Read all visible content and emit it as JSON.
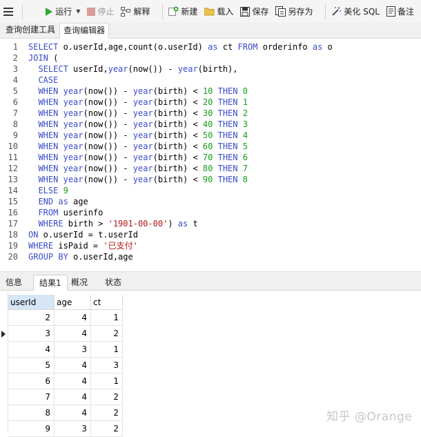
{
  "toolbar": {
    "run": "运行",
    "stop": "停止",
    "explain": "解释",
    "new": "新建",
    "load": "载入",
    "save": "保存",
    "save_as": "另存为",
    "beautify": "美化 SQL",
    "memo": "备注"
  },
  "tabs": [
    "查询创建工具",
    "查询编辑器"
  ],
  "editor": {
    "lines": [
      {
        "n": "1",
        "tokens": [
          [
            "kw",
            "SELECT"
          ],
          [
            "t",
            " o.userId,age,count(o.userId) "
          ],
          [
            "kw",
            "as"
          ],
          [
            "t",
            " ct "
          ],
          [
            "kw",
            "FROM"
          ],
          [
            "t",
            " orderinfo "
          ],
          [
            "kw",
            "as"
          ],
          [
            "t",
            " o"
          ]
        ]
      },
      {
        "n": "2",
        "tokens": [
          [
            "kw",
            "JOIN"
          ],
          [
            "t",
            " ("
          ]
        ]
      },
      {
        "n": "3",
        "tokens": [
          [
            "t",
            "  "
          ],
          [
            "kw",
            "SELECT"
          ],
          [
            "t",
            " userId,"
          ],
          [
            "fn",
            "year"
          ],
          [
            "t",
            "(now()) - "
          ],
          [
            "fn",
            "year"
          ],
          [
            "t",
            "(birth),"
          ]
        ]
      },
      {
        "n": "4",
        "tokens": [
          [
            "t",
            "  "
          ],
          [
            "kw",
            "CASE"
          ]
        ]
      },
      {
        "n": "5",
        "tokens": [
          [
            "t",
            "  "
          ],
          [
            "kw",
            "WHEN"
          ],
          [
            "t",
            " "
          ],
          [
            "fn",
            "year"
          ],
          [
            "t",
            "(now()) - "
          ],
          [
            "fn",
            "year"
          ],
          [
            "t",
            "(birth) < "
          ],
          [
            "num",
            "10"
          ],
          [
            "t",
            " "
          ],
          [
            "kw",
            "THEN"
          ],
          [
            "t",
            " "
          ],
          [
            "num",
            "0"
          ]
        ]
      },
      {
        "n": "6",
        "tokens": [
          [
            "t",
            "  "
          ],
          [
            "kw",
            "WHEN"
          ],
          [
            "t",
            " "
          ],
          [
            "fn",
            "year"
          ],
          [
            "t",
            "(now()) - "
          ],
          [
            "fn",
            "year"
          ],
          [
            "t",
            "(birth) < "
          ],
          [
            "num",
            "20"
          ],
          [
            "t",
            " "
          ],
          [
            "kw",
            "THEN"
          ],
          [
            "t",
            " "
          ],
          [
            "num",
            "1"
          ]
        ]
      },
      {
        "n": "7",
        "tokens": [
          [
            "t",
            "  "
          ],
          [
            "kw",
            "WHEN"
          ],
          [
            "t",
            " "
          ],
          [
            "fn",
            "year"
          ],
          [
            "t",
            "(now()) - "
          ],
          [
            "fn",
            "year"
          ],
          [
            "t",
            "(birth) < "
          ],
          [
            "num",
            "30"
          ],
          [
            "t",
            " "
          ],
          [
            "kw",
            "THEN"
          ],
          [
            "t",
            " "
          ],
          [
            "num",
            "2"
          ]
        ]
      },
      {
        "n": "8",
        "tokens": [
          [
            "t",
            "  "
          ],
          [
            "kw",
            "WHEN"
          ],
          [
            "t",
            " "
          ],
          [
            "fn",
            "year"
          ],
          [
            "t",
            "(now()) - "
          ],
          [
            "fn",
            "year"
          ],
          [
            "t",
            "(birth) < "
          ],
          [
            "num",
            "40"
          ],
          [
            "t",
            " "
          ],
          [
            "kw",
            "THEN"
          ],
          [
            "t",
            " "
          ],
          [
            "num",
            "3"
          ]
        ]
      },
      {
        "n": "9",
        "tokens": [
          [
            "t",
            "  "
          ],
          [
            "kw",
            "WHEN"
          ],
          [
            "t",
            " "
          ],
          [
            "fn",
            "year"
          ],
          [
            "t",
            "(now()) - "
          ],
          [
            "fn",
            "year"
          ],
          [
            "t",
            "(birth) < "
          ],
          [
            "num",
            "50"
          ],
          [
            "t",
            " "
          ],
          [
            "kw",
            "THEN"
          ],
          [
            "t",
            " "
          ],
          [
            "num",
            "4"
          ]
        ]
      },
      {
        "n": "10",
        "tokens": [
          [
            "t",
            "  "
          ],
          [
            "kw",
            "WHEN"
          ],
          [
            "t",
            " "
          ],
          [
            "fn",
            "year"
          ],
          [
            "t",
            "(now()) - "
          ],
          [
            "fn",
            "year"
          ],
          [
            "t",
            "(birth) < "
          ],
          [
            "num",
            "60"
          ],
          [
            "t",
            " "
          ],
          [
            "kw",
            "THEN"
          ],
          [
            "t",
            " "
          ],
          [
            "num",
            "5"
          ]
        ]
      },
      {
        "n": "11",
        "tokens": [
          [
            "t",
            "  "
          ],
          [
            "kw",
            "WHEN"
          ],
          [
            "t",
            " "
          ],
          [
            "fn",
            "year"
          ],
          [
            "t",
            "(now()) - "
          ],
          [
            "fn",
            "year"
          ],
          [
            "t",
            "(birth) < "
          ],
          [
            "num",
            "70"
          ],
          [
            "t",
            " "
          ],
          [
            "kw",
            "THEN"
          ],
          [
            "t",
            " "
          ],
          [
            "num",
            "6"
          ]
        ]
      },
      {
        "n": "12",
        "tokens": [
          [
            "t",
            "  "
          ],
          [
            "kw",
            "WHEN"
          ],
          [
            "t",
            " "
          ],
          [
            "fn",
            "year"
          ],
          [
            "t",
            "(now()) - "
          ],
          [
            "fn",
            "year"
          ],
          [
            "t",
            "(birth) < "
          ],
          [
            "num",
            "80"
          ],
          [
            "t",
            " "
          ],
          [
            "kw",
            "THEN"
          ],
          [
            "t",
            " "
          ],
          [
            "num",
            "7"
          ]
        ]
      },
      {
        "n": "13",
        "tokens": [
          [
            "t",
            "  "
          ],
          [
            "kw",
            "WHEN"
          ],
          [
            "t",
            " "
          ],
          [
            "fn",
            "year"
          ],
          [
            "t",
            "(now()) - "
          ],
          [
            "fn",
            "year"
          ],
          [
            "t",
            "(birth) < "
          ],
          [
            "num",
            "90"
          ],
          [
            "t",
            " "
          ],
          [
            "kw",
            "THEN"
          ],
          [
            "t",
            " "
          ],
          [
            "num",
            "8"
          ]
        ]
      },
      {
        "n": "14",
        "tokens": [
          [
            "t",
            "  "
          ],
          [
            "kw",
            "ELSE"
          ],
          [
            "t",
            " "
          ],
          [
            "num",
            "9"
          ]
        ]
      },
      {
        "n": "15",
        "tokens": [
          [
            "t",
            "  "
          ],
          [
            "kw",
            "END"
          ],
          [
            "t",
            " "
          ],
          [
            "kw",
            "as"
          ],
          [
            "t",
            " age"
          ]
        ]
      },
      {
        "n": "16",
        "tokens": [
          [
            "t",
            "  "
          ],
          [
            "kw",
            "FROM"
          ],
          [
            "t",
            " userinfo"
          ]
        ]
      },
      {
        "n": "17",
        "tokens": [
          [
            "t",
            "  "
          ],
          [
            "kw",
            "WHERE"
          ],
          [
            "t",
            " birth > "
          ],
          [
            "str",
            "'1901-00-00'"
          ],
          [
            "t",
            ") "
          ],
          [
            "kw",
            "as"
          ],
          [
            "t",
            " t"
          ]
        ]
      },
      {
        "n": "18",
        "tokens": [
          [
            "kw",
            "ON"
          ],
          [
            "t",
            " o.userId = t.userId"
          ]
        ]
      },
      {
        "n": "19",
        "tokens": [
          [
            "kw",
            "WHERE"
          ],
          [
            "t",
            " isPaid = "
          ],
          [
            "str",
            "'已支付'"
          ]
        ]
      },
      {
        "n": "20",
        "tokens": [
          [
            "kw",
            "GROUP BY"
          ],
          [
            "t",
            " o.userId,age"
          ]
        ]
      }
    ]
  },
  "result_tabs": [
    "信息",
    "结果1",
    "概况",
    "状态"
  ],
  "result": {
    "columns": [
      "userId",
      "age",
      "ct"
    ],
    "rows": [
      [
        "2",
        "4",
        "1"
      ],
      [
        "3",
        "4",
        "2"
      ],
      [
        "4",
        "3",
        "1"
      ],
      [
        "5",
        "4",
        "3"
      ],
      [
        "6",
        "4",
        "1"
      ],
      [
        "7",
        "4",
        "2"
      ],
      [
        "8",
        "4",
        "2"
      ],
      [
        "9",
        "3",
        "2"
      ]
    ]
  },
  "watermark": "知乎 @Orange",
  "colors": {
    "keyword": "#3a4cc8",
    "number": "#179c17",
    "string": "#b01818",
    "run_icon": "#2fa82f"
  }
}
